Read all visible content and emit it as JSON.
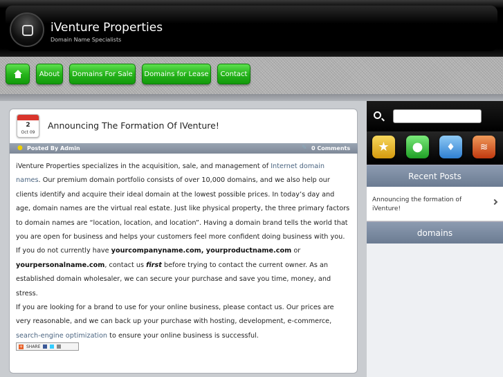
{
  "header": {
    "title": "iVenture Properties",
    "tagline": "Domain Name Specialists"
  },
  "nav": {
    "items": [
      {
        "label": "About"
      },
      {
        "label": "Domains For Sale"
      },
      {
        "label": "Domains for Lease"
      },
      {
        "label": "Contact"
      }
    ]
  },
  "post": {
    "date_day": "2",
    "date_month": "Oct 09",
    "title": "Announcing The Formation Of IVenture!",
    "author": "Posted By Admin",
    "comments": "0 Comments",
    "p1_a": "iVenture Properties specializes in the acquisition, sale, and management of ",
    "p1_link": "Internet domain names",
    "p1_b": ".  Our premium domain portfolio consists of over 10,000 domains, and we also help our clients identify and acquire their ideal domain at the lowest possible prices.  In today’s day and age, domain names are the virtual real estate.  Just like physical property, the three primary factors to domain names are “location, location, and location”.  Having a domain brand tells the world that you are open for business and helps your customers feel more confident doing business with you.  If you do not currently have ",
    "p1_bold1": "yourcompanyname.com, yourproductname.com",
    "p1_or": " or ",
    "p1_bold2": "yourpersonalname.com",
    "p1_c": ", contact us ",
    "p1_first": "first",
    "p1_d": " before trying to contact the current owner.  As an established domain wholesaler, we can secure your purchase and save you time, money, and stress.",
    "p2_a": "If you are looking for a brand to use for your online business, please contact us.  Our prices are very reasonable, and we can back up your purchase with hosting, development, e-commerce, ",
    "p2_link": "search-engine optimization",
    "p2_b": " to ensure your online business is successful.",
    "share_label": "SHARE"
  },
  "sidebar": {
    "search_placeholder": "",
    "recent_posts_title": "Recent Posts",
    "recent_post_1": "Announcing the formation of iVenture!",
    "domains_title": "domains"
  },
  "colors": {
    "nav_green": "#27b51c",
    "header_black": "#000000",
    "sidebar_head": "#7d8ba0",
    "link": "#4a6480"
  }
}
